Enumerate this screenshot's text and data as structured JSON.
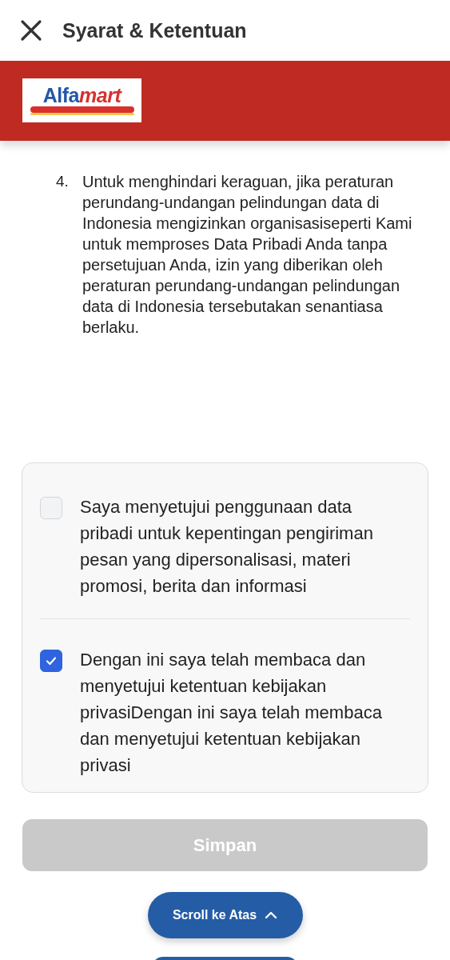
{
  "header": {
    "title": "Syarat & Ketentuan"
  },
  "banner": {
    "logo": [
      "Alfa",
      "mart"
    ]
  },
  "terms": [
    {
      "number": "4.",
      "text": "Untuk menghindari keraguan, jika peraturan perundang-undangan pelindungan data di Indonesia mengizinkan organisasiseperti Kami untuk memproses Data Pribadi Anda tanpa persetujuan Anda, izin yang diberikan oleh peraturan perundang-undangan pelindungan data di Indonesia tersebutakan senantiasa berlaku."
    }
  ],
  "consents": [
    {
      "label": "Saya menyetujui penggunaan data pribadi untuk kepentingan pengiriman pesan yang dipersonalisasi, materi promosi, berita dan informasi",
      "checked": false
    },
    {
      "label": "Dengan ini saya telah membaca dan menyetujui ketentuan kebijakan privasiDengan ini saya telah membaca dan menyetujui ketentuan kebijakan privasi",
      "checked": true
    }
  ],
  "save_button": {
    "label": "Simpan",
    "disabled": true
  },
  "scroll_button": {
    "label": "Scroll ke Atas"
  }
}
